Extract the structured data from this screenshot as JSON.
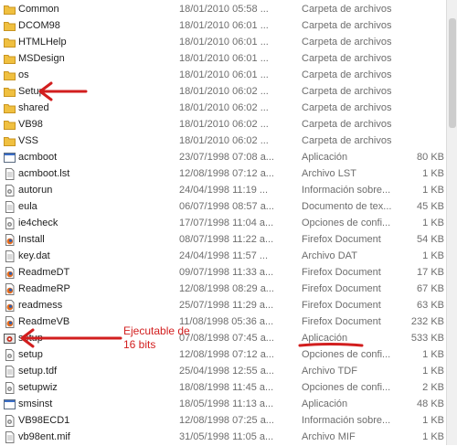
{
  "files": [
    {
      "name": "Common",
      "date": "18/01/2010 05:58 ...",
      "type": "Carpeta de archivos",
      "size": "",
      "icon": "folder-icon"
    },
    {
      "name": "DCOM98",
      "date": "18/01/2010 06:01 ...",
      "type": "Carpeta de archivos",
      "size": "",
      "icon": "folder-icon"
    },
    {
      "name": "HTMLHelp",
      "date": "18/01/2010 06:01 ...",
      "type": "Carpeta de archivos",
      "size": "",
      "icon": "folder-icon"
    },
    {
      "name": "MSDesign",
      "date": "18/01/2010 06:01 ...",
      "type": "Carpeta de archivos",
      "size": "",
      "icon": "folder-icon"
    },
    {
      "name": "os",
      "date": "18/01/2010 06:01 ...",
      "type": "Carpeta de archivos",
      "size": "",
      "icon": "folder-icon"
    },
    {
      "name": "Setup",
      "date": "18/01/2010 06:02 ...",
      "type": "Carpeta de archivos",
      "size": "",
      "icon": "folder-icon"
    },
    {
      "name": "shared",
      "date": "18/01/2010 06:02 ...",
      "type": "Carpeta de archivos",
      "size": "",
      "icon": "folder-icon"
    },
    {
      "name": "VB98",
      "date": "18/01/2010 06:02 ...",
      "type": "Carpeta de archivos",
      "size": "",
      "icon": "folder-icon"
    },
    {
      "name": "VSS",
      "date": "18/01/2010 06:02 ...",
      "type": "Carpeta de archivos",
      "size": "",
      "icon": "folder-icon"
    },
    {
      "name": "acmboot",
      "date": "23/07/1998 07:08 a...",
      "type": "Aplicación",
      "size": "80 KB",
      "icon": "application-icon"
    },
    {
      "name": "acmboot.lst",
      "date": "12/08/1998 07:12 a...",
      "type": "Archivo LST",
      "size": "1 KB",
      "icon": "document-icon"
    },
    {
      "name": "autorun",
      "date": "24/04/1998 11:19 ...",
      "type": "Información sobre...",
      "size": "1 KB",
      "icon": "settings-file-icon"
    },
    {
      "name": "eula",
      "date": "06/07/1998 08:57 a...",
      "type": "Documento de tex...",
      "size": "45 KB",
      "icon": "document-icon"
    },
    {
      "name": "ie4check",
      "date": "17/07/1998 11:04 a...",
      "type": "Opciones de confi...",
      "size": "1 KB",
      "icon": "settings-file-icon"
    },
    {
      "name": "Install",
      "date": "08/07/1998 11:22 a...",
      "type": "Firefox Document",
      "size": "54 KB",
      "icon": "firefox-document-icon"
    },
    {
      "name": "key.dat",
      "date": "24/04/1998 11:57 ...",
      "type": "Archivo DAT",
      "size": "1 KB",
      "icon": "document-icon"
    },
    {
      "name": "ReadmeDT",
      "date": "09/07/1998 11:33 a...",
      "type": "Firefox Document",
      "size": "17 KB",
      "icon": "firefox-document-icon"
    },
    {
      "name": "ReadmeRP",
      "date": "12/08/1998 08:29 a...",
      "type": "Firefox Document",
      "size": "67 KB",
      "icon": "firefox-document-icon"
    },
    {
      "name": "readmess",
      "date": "25/07/1998 11:29 a...",
      "type": "Firefox Document",
      "size": "63 KB",
      "icon": "firefox-document-icon"
    },
    {
      "name": "ReadmeVB",
      "date": "11/08/1998 05:36 a...",
      "type": "Firefox Document",
      "size": "232 KB",
      "icon": "firefox-document-icon"
    },
    {
      "name": "setup",
      "date": "07/08/1998 07:45 a...",
      "type": "Aplicación",
      "size": "533 KB",
      "icon": "setup-application-icon"
    },
    {
      "name": "setup",
      "date": "12/08/1998 07:12 a...",
      "type": "Opciones de confi...",
      "size": "1 KB",
      "icon": "settings-file-icon"
    },
    {
      "name": "setup.tdf",
      "date": "25/04/1998 12:55 a...",
      "type": "Archivo TDF",
      "size": "1 KB",
      "icon": "document-icon"
    },
    {
      "name": "setupwiz",
      "date": "18/08/1998 11:45 a...",
      "type": "Opciones de confi...",
      "size": "2 KB",
      "icon": "settings-file-icon"
    },
    {
      "name": "smsinst",
      "date": "18/05/1998 11:13 a...",
      "type": "Aplicación",
      "size": "48 KB",
      "icon": "application-icon"
    },
    {
      "name": "VB98ECD1",
      "date": "12/08/1998 07:25 a...",
      "type": "Información sobre...",
      "size": "1 KB",
      "icon": "settings-file-icon"
    },
    {
      "name": "vb98ent.mif",
      "date": "31/05/1998 11:05 a...",
      "type": "Archivo MIF",
      "size": "1 KB",
      "icon": "document-icon"
    }
  ],
  "annotation": {
    "line1": "Ejecutable de",
    "line2": "16 bits"
  },
  "colors": {
    "annotation_red": "#d21e1e",
    "folder_yellow": "#f0c040",
    "firefox_orange": "#e06a1e"
  }
}
